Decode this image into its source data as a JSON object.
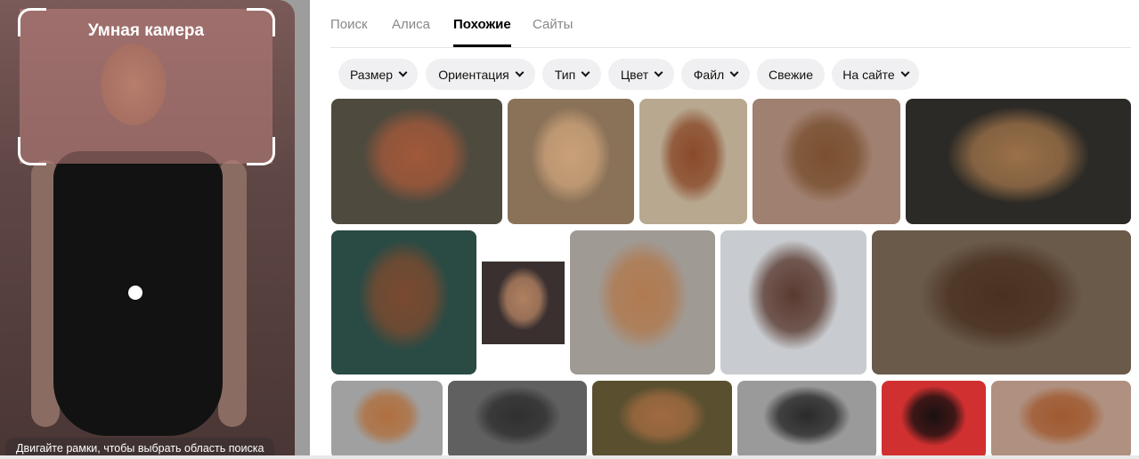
{
  "camera": {
    "title": "Умная камера",
    "hint": "Двигайте рамки, чтобы выбрать область поиска"
  },
  "tabs": [
    {
      "label": "Поиск"
    },
    {
      "label": "Алиса"
    },
    {
      "label": "Похожие",
      "active": true
    },
    {
      "label": "Сайты"
    }
  ],
  "filters": [
    {
      "label": "Размер"
    },
    {
      "label": "Ориентация"
    },
    {
      "label": "Тип"
    },
    {
      "label": "Цвет"
    },
    {
      "label": "Файл"
    },
    {
      "label": "Свежие"
    },
    {
      "label": "На сайте"
    }
  ],
  "results_count": 17
}
